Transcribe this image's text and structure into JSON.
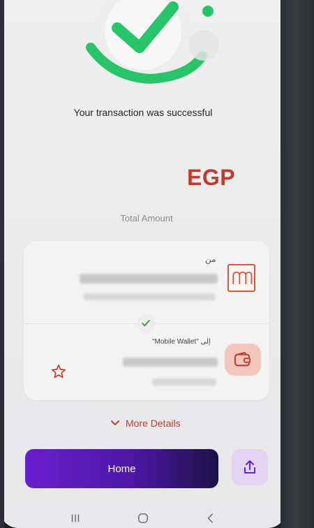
{
  "status": {
    "message": "Your transaction was successful"
  },
  "amount": {
    "currency": "EGP",
    "label": "Total Amount"
  },
  "transfer": {
    "from_label": "من",
    "to_label": "\"Mobile Wallet\"  إلى"
  },
  "actions": {
    "more_details": "More Details",
    "home": "Home"
  },
  "colors": {
    "accent_red": "#c6392d",
    "primary_purple": "#6a1fd0",
    "success_green": "#27c46a"
  },
  "icons": {
    "hero": "success-check-icon",
    "bank": "bank-icon",
    "wallet": "wallet-icon",
    "favorite": "star-icon",
    "expand": "chevron-down-icon",
    "share": "share-icon"
  }
}
